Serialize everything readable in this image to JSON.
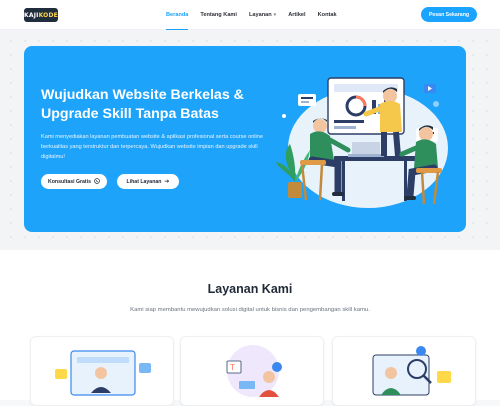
{
  "header": {
    "logo_text": "KAJI",
    "logo_accent": "KODE",
    "nav": [
      {
        "label": "Beranda",
        "active": true
      },
      {
        "label": "Tentang Kami",
        "active": false
      },
      {
        "label": "Layanan",
        "active": false,
        "has_dropdown": true
      },
      {
        "label": "Artikel",
        "active": false
      },
      {
        "label": "Kontak",
        "active": false
      }
    ],
    "cta_label": "Pesan Sekarang"
  },
  "hero": {
    "title": "Wujudkan Website Berkelas & Upgrade Skill Tanpa Batas",
    "description": "Kami menyediakan layanan pembuatan website & aplikasi profesional serta course online berkualitas yang terstruktur dan terpercaya. Wujudkan website impian dan upgrade skill digitalmu!",
    "primary_button": "Konsultasi Gratis",
    "primary_icon": "whatsapp-icon",
    "secondary_button": "Lihat Layanan",
    "secondary_icon": "arrow-right-icon"
  },
  "services": {
    "title": "Layanan Kami",
    "subtitle": "Kami siap membantu mewujudkan solusi digital untuk bisnis dan pengembangan skill kamu."
  },
  "colors": {
    "primary": "#1aa3ff",
    "hero_bg": "#1ea3fa",
    "text_dark": "#1f2937"
  }
}
